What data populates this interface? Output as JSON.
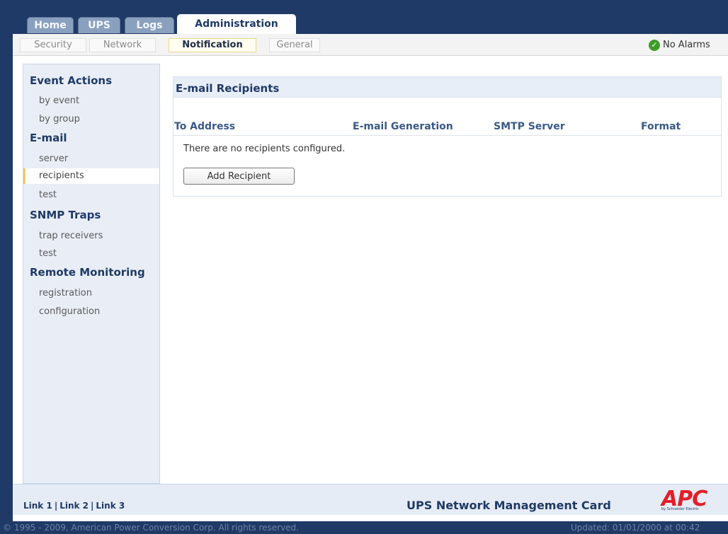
{
  "tabs": {
    "home": "Home",
    "ups": "UPS",
    "logs": "Logs",
    "administration": "Administration"
  },
  "subnav": {
    "security": "Security",
    "network": "Network",
    "notification": "Notification",
    "general": "General"
  },
  "alarm_status": "No Alarms",
  "sidebar": {
    "event_actions": "Event Actions",
    "by_event": "by event",
    "by_group": "by group",
    "email": "E-mail",
    "server": "server",
    "recipients": "recipients",
    "email_test": "test",
    "snmp_traps": "SNMP Traps",
    "trap_receivers": "trap receivers",
    "snmp_test": "test",
    "remote_monitoring": "Remote Monitoring",
    "registration": "registration",
    "configuration": "configuration"
  },
  "content": {
    "title": "E-mail Recipients",
    "columns": [
      "To Address",
      "E-mail Generation",
      "SMTP Server",
      "Format"
    ],
    "empty_message": "There are no recipients configured.",
    "add_button": "Add Recipient"
  },
  "footer": {
    "links": [
      "Link 1",
      "Link 2",
      "Link 3"
    ],
    "separator": "|",
    "product": "UPS Network Management Card",
    "logo": "APC",
    "logo_sub": "by Schneider Electric",
    "copyright": "© 1995 - 2009, American Power Conversion Corp. All rights reserved.",
    "updated": "Updated: 01/01/2000 at 00:42"
  },
  "colors": {
    "navy": "#1f3a66",
    "accent_green": "#3f9b2c",
    "logo_red": "#e0202a"
  }
}
